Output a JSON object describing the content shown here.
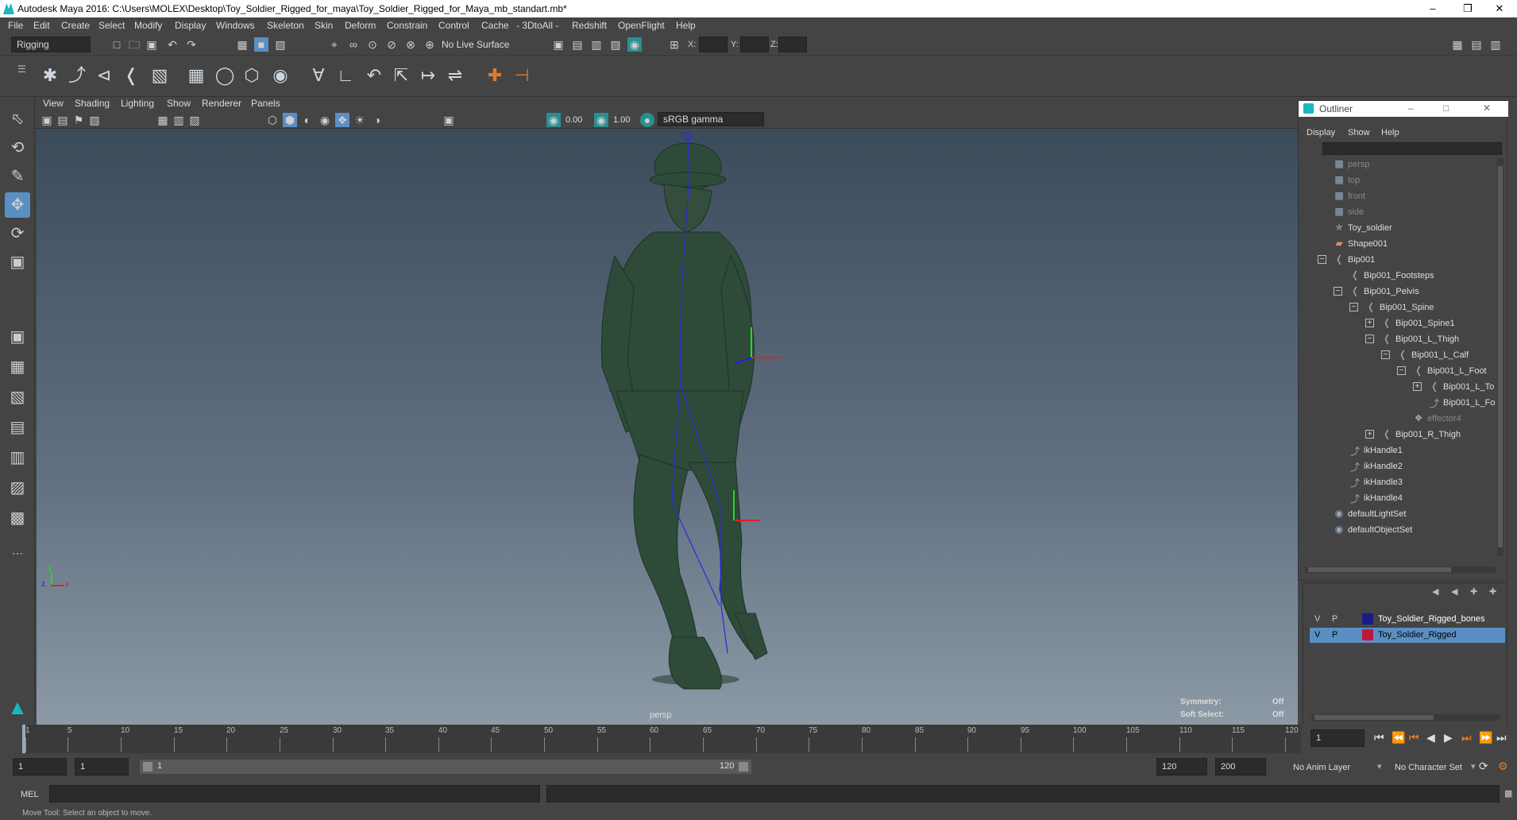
{
  "title_bar": {
    "title": "Autodesk Maya 2016: C:\\Users\\MOLEX\\Desktop\\Toy_Soldier_Rigged_for_maya\\Toy_Soldier_Rigged_for_Maya_mb_standart.mb*"
  },
  "menu": {
    "items": [
      "File",
      "Edit",
      "Create",
      "Select",
      "Modify",
      "Display",
      "Windows",
      "Skeleton",
      "Skin",
      "Deform",
      "Constrain",
      "Control",
      "Cache",
      "- 3DtoAll -",
      "Redshift",
      "OpenFlight",
      "Help"
    ]
  },
  "status_line": {
    "menu_set": "Rigging",
    "live_surface": "No Live Surface",
    "x_label": "X:",
    "y_label": "Y:",
    "z_label": "Z:"
  },
  "panel_menu": {
    "items": [
      "View",
      "Shading",
      "Lighting",
      "Show",
      "Renderer",
      "Panels"
    ]
  },
  "panel_toolbar": {
    "exposure": "0.00",
    "gamma": "1.00",
    "color_space": "sRGB gamma"
  },
  "viewport": {
    "camera_label": "persp",
    "symmetry_label": "Symmetry:",
    "symmetry_value": "Off",
    "soft_select_label": "Soft Select:",
    "soft_select_value": "Off",
    "axis_x": "x",
    "axis_y": "y",
    "axis_z": "z"
  },
  "outliner": {
    "title": "Outliner",
    "menu": [
      "Display",
      "Show",
      "Help"
    ],
    "items": [
      {
        "label": "persp",
        "dim": true,
        "icon": "camera-icon"
      },
      {
        "label": "top",
        "dim": true,
        "icon": "camera-icon"
      },
      {
        "label": "front",
        "dim": true,
        "icon": "camera-icon"
      },
      {
        "label": "side",
        "dim": true,
        "icon": "camera-icon"
      },
      {
        "label": "Toy_soldier",
        "dim": false,
        "icon": "transform-icon"
      },
      {
        "label": "Shape001",
        "dim": false,
        "icon": "shape-icon"
      },
      {
        "label": "Bip001",
        "dim": false,
        "icon": "joint-icon"
      },
      {
        "label": "Bip001_Footsteps",
        "dim": false,
        "icon": "joint-icon"
      },
      {
        "label": "Bip001_Pelvis",
        "dim": false,
        "icon": "joint-icon"
      },
      {
        "label": "Bip001_Spine",
        "dim": false,
        "icon": "joint-icon"
      },
      {
        "label": "Bip001_Spine1",
        "dim": false,
        "icon": "joint-icon"
      },
      {
        "label": "Bip001_L_Thigh",
        "dim": false,
        "icon": "joint-icon"
      },
      {
        "label": "Bip001_L_Calf",
        "dim": false,
        "icon": "joint-icon"
      },
      {
        "label": "Bip001_L_Foot",
        "dim": false,
        "icon": "joint-icon"
      },
      {
        "label": "Bip001_L_To",
        "dim": false,
        "icon": "joint-icon"
      },
      {
        "label": "Bip001_L_Fo",
        "dim": false,
        "icon": "ik-icon"
      },
      {
        "label": "effector4",
        "dim": true,
        "icon": "effector-icon"
      },
      {
        "label": "Bip001_R_Thigh",
        "dim": false,
        "icon": "joint-icon"
      },
      {
        "label": "ikHandle1",
        "dim": false,
        "icon": "ik-icon"
      },
      {
        "label": "ikHandle2",
        "dim": false,
        "icon": "ik-icon"
      },
      {
        "label": "ikHandle3",
        "dim": false,
        "icon": "ik-icon"
      },
      {
        "label": "ikHandle4",
        "dim": false,
        "icon": "ik-icon"
      },
      {
        "label": "defaultLightSet",
        "dim": false,
        "icon": "set-icon"
      },
      {
        "label": "defaultObjectSet",
        "dim": false,
        "icon": "set-icon"
      }
    ]
  },
  "layers": {
    "rows": [
      {
        "v": "V",
        "p": "P",
        "name": "Toy_Soldier_Rigged_bones",
        "color": "#1a1a8a",
        "selected": false
      },
      {
        "v": "V",
        "p": "P",
        "name": "Toy_Soldier_Rigged",
        "color": "#c0183a",
        "selected": true
      }
    ]
  },
  "timeline": {
    "ticks": [
      "1",
      "5",
      "10",
      "15",
      "20",
      "25",
      "30",
      "35",
      "40",
      "45",
      "50",
      "55",
      "60",
      "65",
      "70",
      "75",
      "80",
      "85",
      "90",
      "95",
      "100",
      "105",
      "110",
      "115",
      "120"
    ],
    "current_frame": "1"
  },
  "range": {
    "start": "1",
    "current": "1",
    "range_start_label": "1",
    "range_end_label": "120",
    "end": "120",
    "max": "200",
    "anim_layer": "No Anim Layer",
    "character_set": "No Character Set"
  },
  "command_line": {
    "mode": "MEL"
  },
  "help_line": {
    "text": "Move Tool: Select an object to move."
  },
  "colors": {
    "background": "#444444",
    "accent": "#5a8fc4",
    "model": "#2f4a38"
  }
}
